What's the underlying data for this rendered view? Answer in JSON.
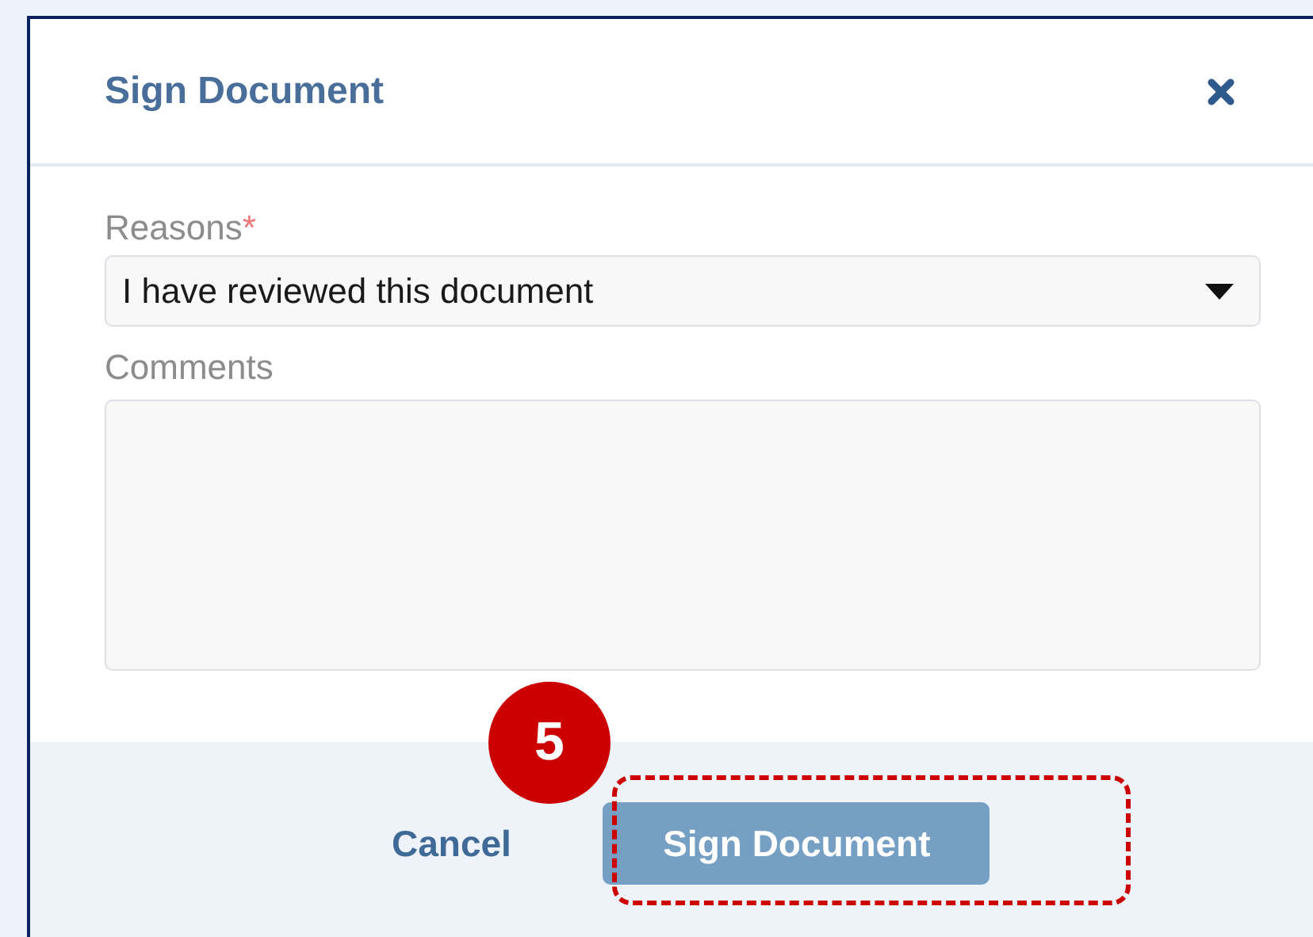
{
  "dialog": {
    "title": "Sign Document"
  },
  "fields": [
    {
      "kind": "select",
      "label": "Reasons",
      "required_mark": "*",
      "value": "I have reviewed this document"
    },
    {
      "kind": "textarea",
      "label": "Comments"
    }
  ],
  "buttons": [
    {
      "kind": "link",
      "label": "Cancel",
      "disabled": false
    },
    {
      "kind": "primary",
      "label": "Sign Document",
      "disabled": true
    }
  ],
  "callout": {
    "step": "5"
  }
}
